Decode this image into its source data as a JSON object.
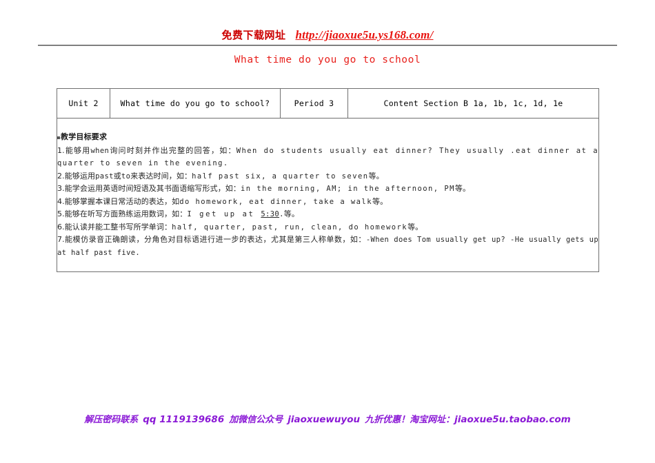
{
  "banner": {
    "label_cn": "免费下载网址",
    "url": "http://jiaoxue5u.ys168.com/",
    "color_cn": "#cc0000",
    "color_url": "#e8130f"
  },
  "title": {
    "text": "What time do you go to school",
    "color": "#e8201c"
  },
  "table": {
    "header": {
      "unit": "Unit 2",
      "topic": "What time do you go to school?",
      "period": "Period 3",
      "content": "Content  Section B  1a, 1b, 1c, 1d, 1e"
    },
    "body": {
      "heading": "教学目标要求",
      "objectives": [
        {
          "index": "1.",
          "cn_a": "能够用",
          "en_a": "when",
          "cn_b": "询问时刻并作出完整的回答，如：",
          "en_b": "When do students usually eat dinner? They usually .eat dinner at a quarter to seven in the evening."
        },
        {
          "index": "2.",
          "cn_a": "能够运用",
          "en_a": "past",
          "cn_b": "或",
          "en_b": "to",
          "cn_c": "来表达时间，如：",
          "en_c": "half past six, a quarter to seven",
          "cn_d": "等。"
        },
        {
          "index": "3.",
          "cn_a": "能学会运用英语时间短语及其书面语缩写形式，如：",
          "en_a": "in the morning, AM; in the afternoon, PM",
          "cn_b": "等。"
        },
        {
          "index": "4.",
          "cn_a": "能够掌握本课日常活动的表达，如",
          "en_a": "do homework, eat dinner, take a walk",
          "cn_b": "等。"
        },
        {
          "index": "5.",
          "cn_a": "能够在听写方面熟练运用数词，如：",
          "en_a": "I get up at ",
          "en_underlined": "5:30",
          "en_b": ".",
          "cn_b": "等。"
        },
        {
          "index": "6.",
          "cn_a": "能认读并能工整书写所学单词：",
          "en_a": "half, quarter, past, run, clean, do homework",
          "cn_b": "等。"
        },
        {
          "index": "7.",
          "cn_a": "能模仿录音正确朗读，分角色对目标语进行进一步的表达，尤其是第三人称单数，如：",
          "en_a": "-When does Tom usually get up? -He usually gets up at half past five."
        }
      ]
    }
  },
  "footer": {
    "part1": "解压密码联系",
    "part2": "qq 1119139686",
    "part3": "加微信公众号",
    "part4": "jiaoxuewuyou",
    "part5": "九折优惠！淘宝网址：",
    "part6": "jiaoxue5u.taobao.com",
    "color": "#8b1ad6"
  }
}
